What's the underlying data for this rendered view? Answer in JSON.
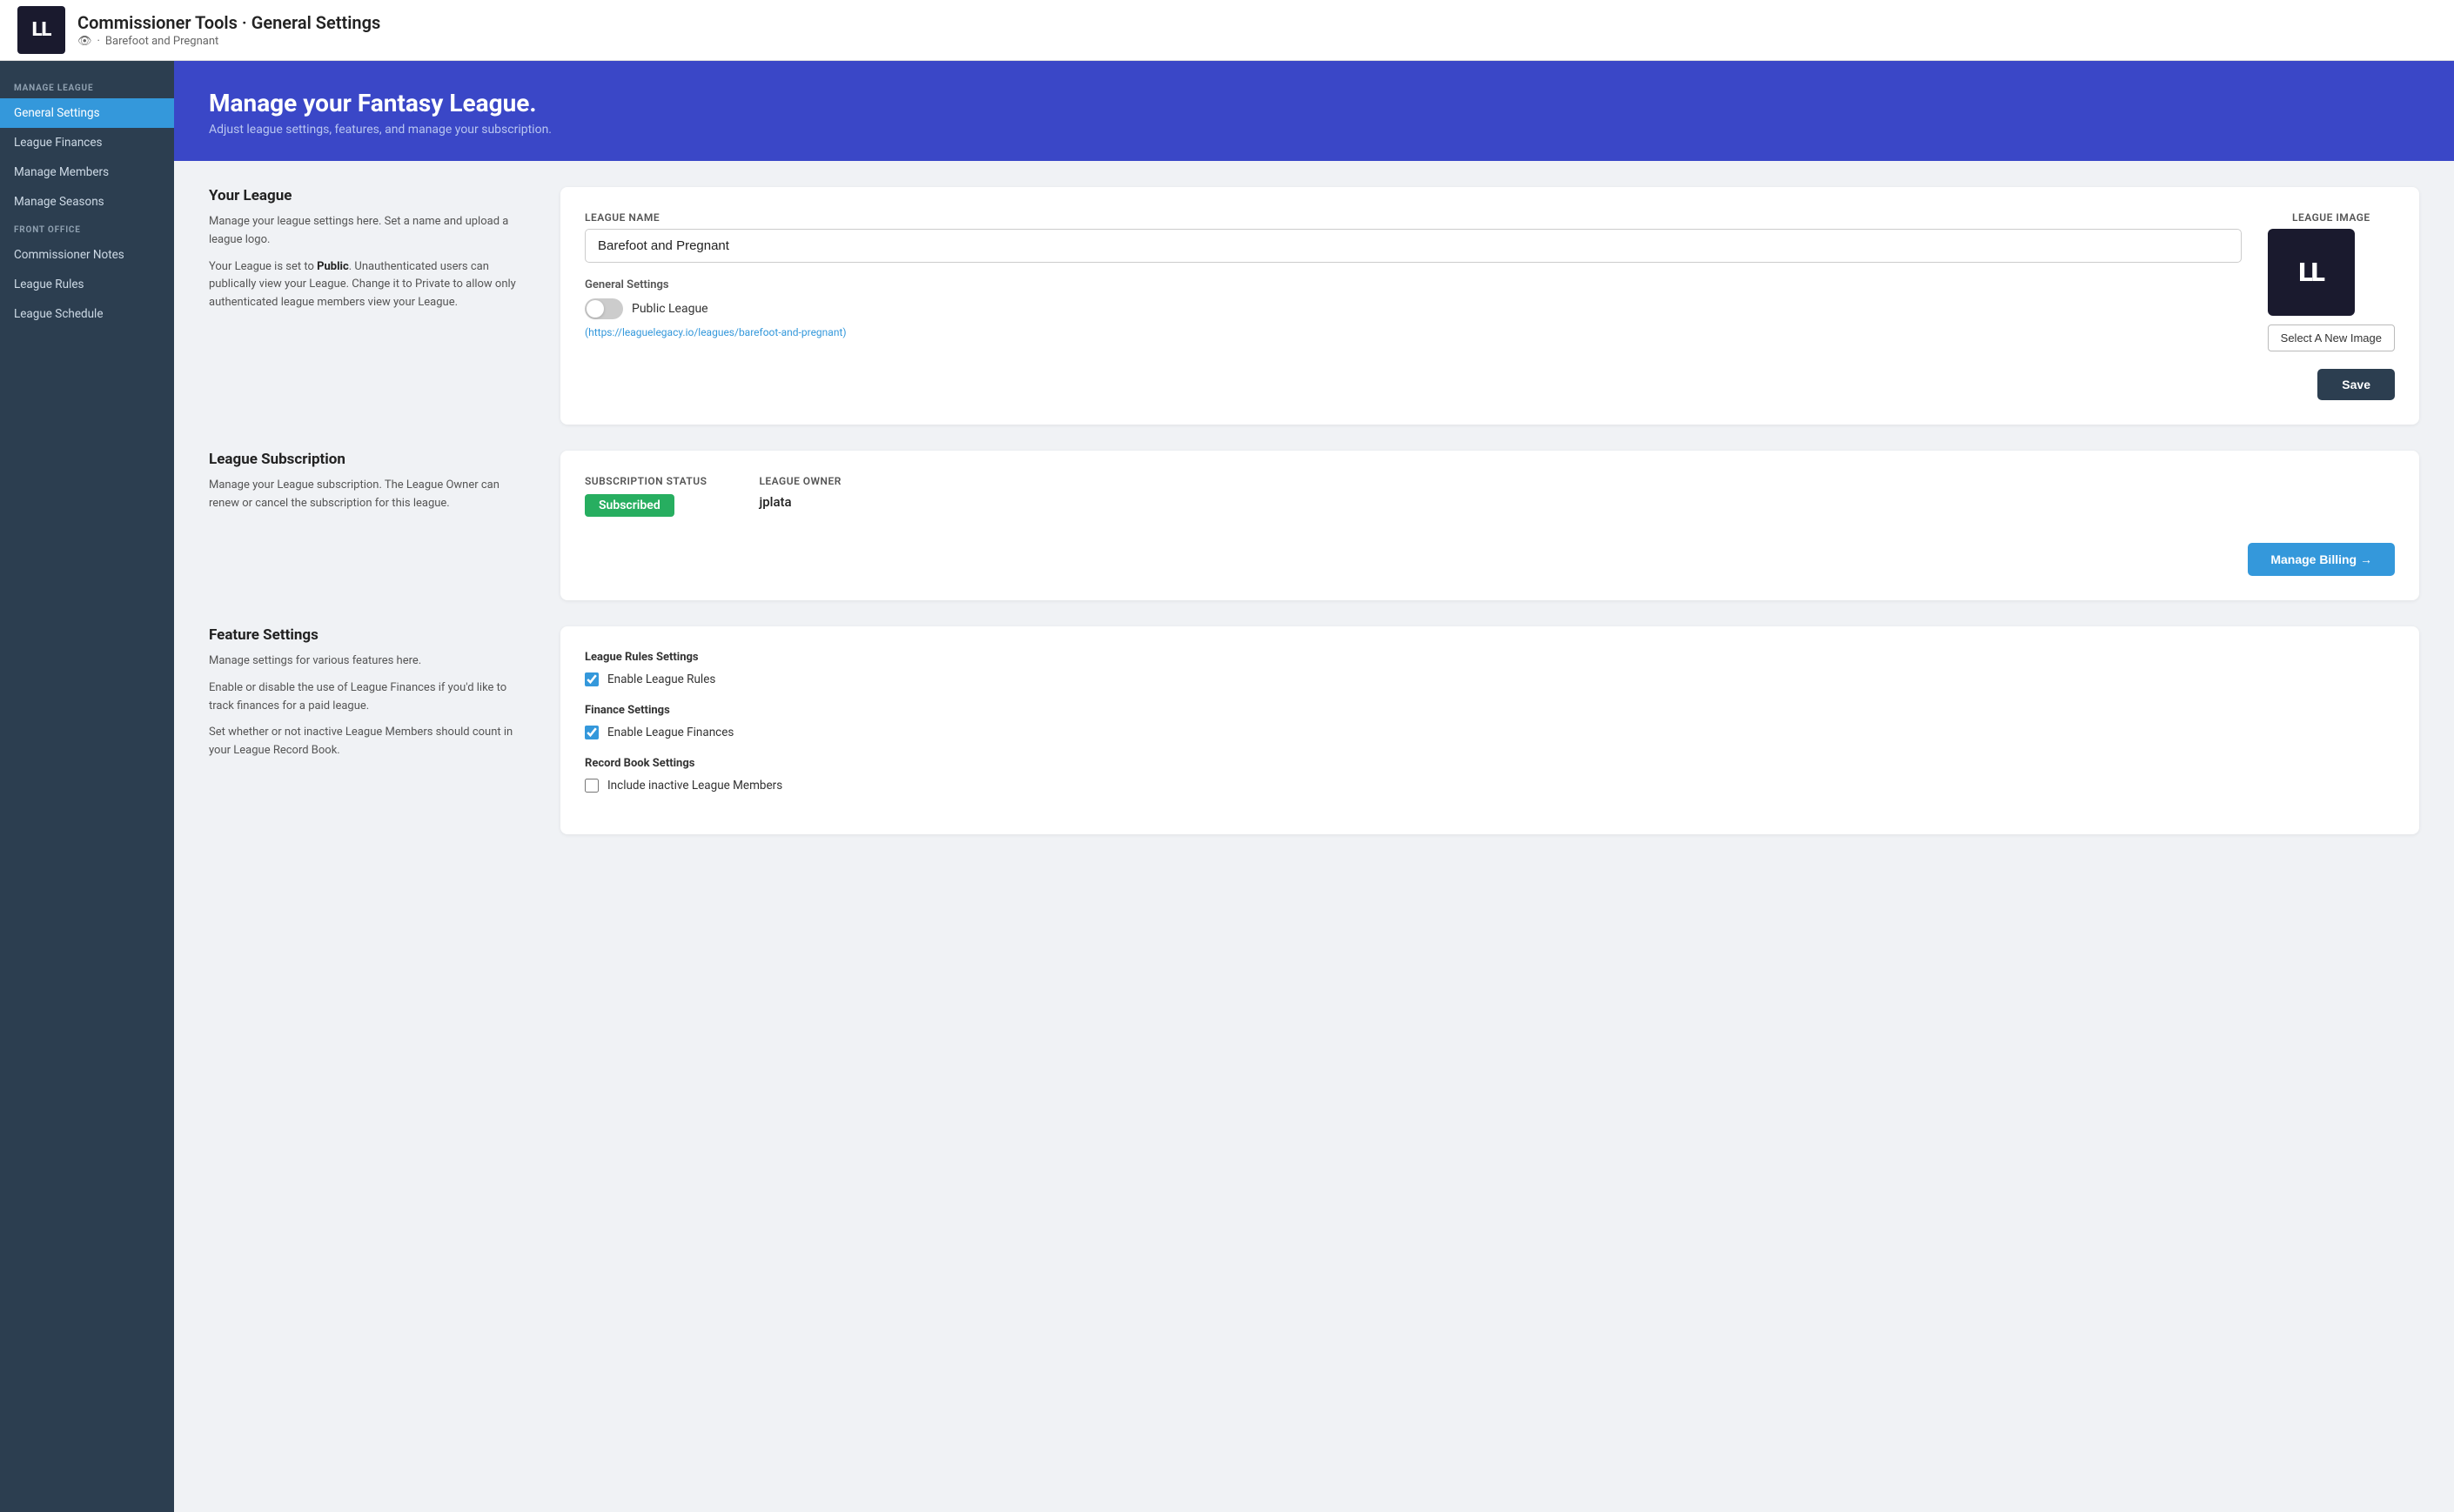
{
  "header": {
    "logo_text": "LL",
    "title": "Commissioner Tools · General Settings",
    "eye_icon": "👁",
    "subtitle_dot": "·",
    "subtitle_league": "Barefoot and Pregnant"
  },
  "sidebar": {
    "manage_league_label": "MANAGE LEAGUE",
    "front_office_label": "FRONT OFFICE",
    "items": [
      {
        "id": "general-settings",
        "label": "General Settings",
        "active": true
      },
      {
        "id": "league-finances",
        "label": "League Finances",
        "active": false
      },
      {
        "id": "manage-members",
        "label": "Manage Members",
        "active": false
      },
      {
        "id": "manage-seasons",
        "label": "Manage Seasons",
        "active": false
      },
      {
        "id": "commissioner-notes",
        "label": "Commissioner Notes",
        "active": false
      },
      {
        "id": "league-rules",
        "label": "League Rules",
        "active": false
      },
      {
        "id": "league-schedule",
        "label": "League Schedule",
        "active": false
      }
    ]
  },
  "hero": {
    "title": "Manage your Fantasy League.",
    "subtitle": "Adjust league settings, features, and manage your subscription."
  },
  "your_league": {
    "section_title": "Your League",
    "desc1": "Manage your league settings here. Set a name and upload a league logo.",
    "desc2_prefix": "Your League is set to ",
    "desc2_highlight": "Public",
    "desc2_suffix": ". Unauthenticated users can publically view your League. Change it to Private to allow only authenticated league members view your League.",
    "league_name_label": "League Name",
    "league_name_value": "Barefoot and Pregnant",
    "league_name_placeholder": "League Name",
    "general_settings_label": "General Settings",
    "public_league_label": "Public League",
    "league_url": "(https://leaguelegacy.io/leagues/barefoot-and-pregnant)",
    "league_image_label": "League Image",
    "logo_text": "LL",
    "select_image_btn": "Select A New Image",
    "save_btn": "Save"
  },
  "league_subscription": {
    "section_title": "League Subscription",
    "desc1": "Manage your League subscription. The League Owner can renew or cancel the subscription for this league.",
    "subscription_status_label": "Subscription Status",
    "subscribed_badge": "Subscribed",
    "league_owner_label": "League Owner",
    "owner_name": "jplata",
    "manage_billing_btn": "Manage Billing →"
  },
  "feature_settings": {
    "section_title": "Feature Settings",
    "desc1": "Manage settings for various features here.",
    "desc2": "Enable or disable the use of League Finances if you'd like to track finances for a paid league.",
    "desc3": "Set whether or not inactive League Members should count in your League Record Book.",
    "league_rules_group_title": "League Rules Settings",
    "enable_league_rules_label": "Enable League Rules",
    "finance_group_title": "Finance Settings",
    "enable_finances_label": "Enable League Finances",
    "record_book_group_title": "Record Book Settings",
    "include_inactive_label": "Include inactive League Members"
  }
}
